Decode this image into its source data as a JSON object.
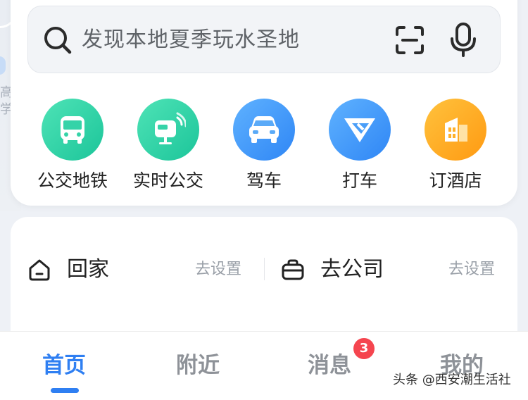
{
  "search": {
    "placeholder": "发现本地夏季玩水圣地"
  },
  "quick_actions": [
    {
      "label": "公交地铁",
      "icon": "bus-icon",
      "color": "#1cc59a"
    },
    {
      "label": "实时公交",
      "icon": "realtime-bus-icon",
      "color": "#1cc59a"
    },
    {
      "label": "驾车",
      "icon": "car-icon",
      "color": "#2f86f5"
    },
    {
      "label": "打车",
      "icon": "taxi-icon",
      "color": "#2f86f5",
      "active": true
    },
    {
      "label": "订酒店",
      "icon": "hotel-icon",
      "color": "#ff9a12"
    }
  ],
  "map": {
    "partial_text": "高 学"
  },
  "shortcuts": {
    "home": {
      "label": "回家",
      "action": "去设置"
    },
    "work": {
      "label": "去公司",
      "action": "去设置"
    }
  },
  "tabbar": {
    "tabs": [
      {
        "label": "首页",
        "active": true
      },
      {
        "label": "附近",
        "active": false
      },
      {
        "label": "消息",
        "active": false,
        "badge": "3"
      },
      {
        "label": "我的",
        "active": false
      }
    ]
  },
  "watermark": "头条 @西安潮生活社",
  "colors": {
    "accent": "#2f7ff2",
    "active_underline": "#ef1f29",
    "badge": "#f5454f"
  }
}
